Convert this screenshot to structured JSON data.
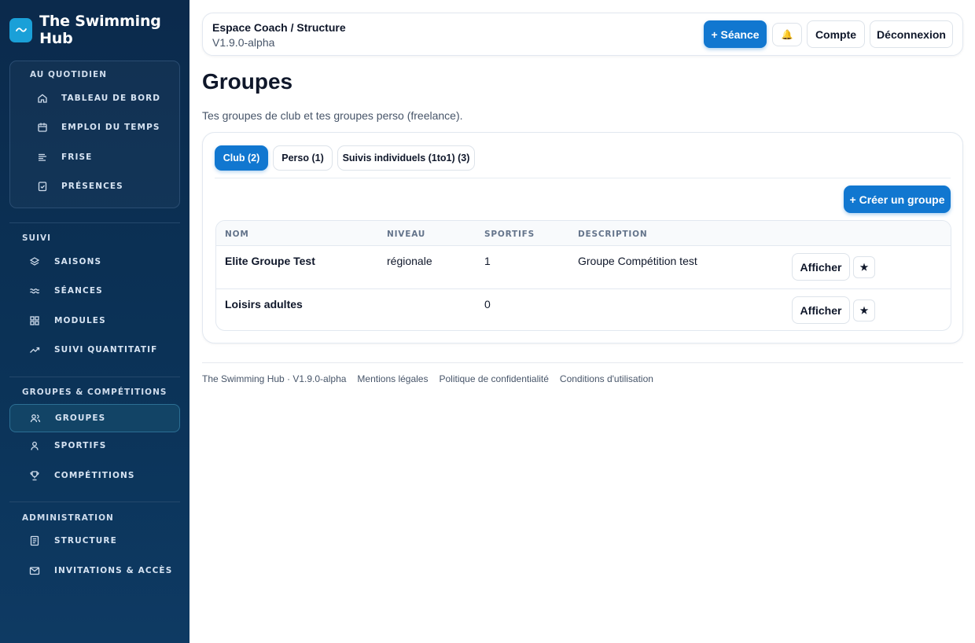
{
  "brand": {
    "name": "The Swimming Hub"
  },
  "sidebar": {
    "quotidien": {
      "title": "AU QUOTIDIEN",
      "items": [
        {
          "label": "TABLEAU DE BORD",
          "icon": "home-icon"
        },
        {
          "label": "EMPLOI DU TEMPS",
          "icon": "calendar-icon"
        },
        {
          "label": "FRISE",
          "icon": "timeline-icon"
        },
        {
          "label": "PRÉSENCES",
          "icon": "checklist-icon"
        }
      ]
    },
    "suivi": {
      "title": "SUIVI",
      "items": [
        {
          "label": "SAISONS",
          "icon": "layers-icon"
        },
        {
          "label": "SÉANCES",
          "icon": "waves-icon"
        },
        {
          "label": "MODULES",
          "icon": "grid-icon"
        },
        {
          "label": "SUIVI QUANTITATIF",
          "icon": "trend-icon"
        }
      ]
    },
    "groupes": {
      "title": "GROUPES & COMPÉTITIONS",
      "items": [
        {
          "label": "GROUPES",
          "icon": "users-icon"
        },
        {
          "label": "SPORTIFS",
          "icon": "user-icon"
        },
        {
          "label": "COMPÉTITIONS",
          "icon": "trophy-icon"
        }
      ]
    },
    "admin": {
      "title": "ADMINISTRATION",
      "items": [
        {
          "label": "STRUCTURE",
          "icon": "document-icon"
        },
        {
          "label": "INVITATIONS & ACCÈS",
          "icon": "mail-icon"
        }
      ]
    }
  },
  "topbar": {
    "breadcrumb": "Espace Coach / Structure",
    "version": "V1.9.0-alpha",
    "new_session": "+ Séance",
    "bell": "🔔",
    "account": "Compte",
    "logout": "Déconnexion"
  },
  "page": {
    "title": "Groupes",
    "subtitle": "Tes groupes de club et tes groupes perso (freelance)."
  },
  "tabs": [
    "Club (2)",
    "Perso (1)",
    "Suivis individuels (1to1) (3)"
  ],
  "create_group": "+ Créer un groupe",
  "table": {
    "headers": [
      "NOM",
      "NIVEAU",
      "SPORTIFS",
      "DESCRIPTION"
    ],
    "rows": [
      {
        "nom": "Elite Groupe Test",
        "niveau": "régionale",
        "sportifs": "1",
        "description": "Groupe Compétition test",
        "action": "Afficher",
        "star": "★"
      },
      {
        "nom": "Loisirs adultes",
        "niveau": "",
        "sportifs": "0",
        "description": "",
        "action": "Afficher",
        "star": "★"
      }
    ]
  },
  "footer": {
    "links": [
      "The Swimming Hub · V1.9.0-alpha",
      "Mentions légales",
      "Politique de confidentialité",
      "Conditions d'utilisation"
    ]
  },
  "colors": {
    "accent": "#1177d0",
    "sidebar": "#0b2a4c",
    "logo": "#1aa0d8"
  }
}
